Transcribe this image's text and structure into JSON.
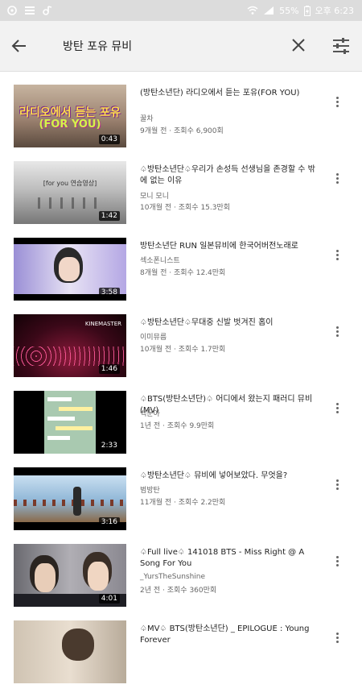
{
  "status_bar": {
    "battery": "55%",
    "time": "오후 6:23"
  },
  "search": {
    "query": "방탄 포유 뮤비"
  },
  "videos": [
    {
      "title": "(방탄소년단) 라디오에서 듣는 포유(FOR YOU)",
      "channel": "꿀차",
      "age": "9개월 전",
      "views": "조회수 6,900회",
      "duration": "0:43",
      "thumb_text": "라디오에서 듣는 포유",
      "thumb_text2": "(FOR YOU)"
    },
    {
      "title": "♤방탄소년단♤우리가 손성득 선생님을 존경할 수 밖에 없는 이유",
      "channel": "모니 모니",
      "age": "10개월 전",
      "views": "조회수 15.3만회",
      "duration": "1:42",
      "thumb_text": "[for you 연습영상]"
    },
    {
      "title": "방탄소년단 RUN 일본뮤비에 한국어버전노래로",
      "channel": "섹소폰니스트",
      "age": "8개월 전",
      "views": "조회수 12.4만회",
      "duration": "3:58"
    },
    {
      "title": "♤방탄소년단♤무대중 신발 벗겨진 홉이",
      "channel": "이미뮤름",
      "age": "10개월 전",
      "views": "조회수 1.7만회",
      "duration": "1:46",
      "thumb_text": "KINEMASTER"
    },
    {
      "title": "♤BTS(방탄소년단)♤ 어디에서 왔는지 패러디 뮤비(MV)",
      "channel": "백문아",
      "age": "1년 전",
      "views": "조회수 9.9만회",
      "duration": "2:33"
    },
    {
      "title": "♤방탄소년단♤ 뮤비에 넣어보았다. 무엇을?",
      "channel": "범방탄",
      "age": "11개월 전",
      "views": "조회수 2.2만회",
      "duration": "3:16"
    },
    {
      "title": "♤Full live♤ 141018 BTS - Miss Right @ A Song For You",
      "channel": "_YursTheSunshine",
      "age": "2년 전",
      "views": "조회수 360만회",
      "duration": "4:01"
    },
    {
      "title": "♤MV♤ BTS(방탄소년단) _ EPILOGUE : Young Forever",
      "channel": "",
      "age": "",
      "views": "",
      "duration": ""
    }
  ]
}
